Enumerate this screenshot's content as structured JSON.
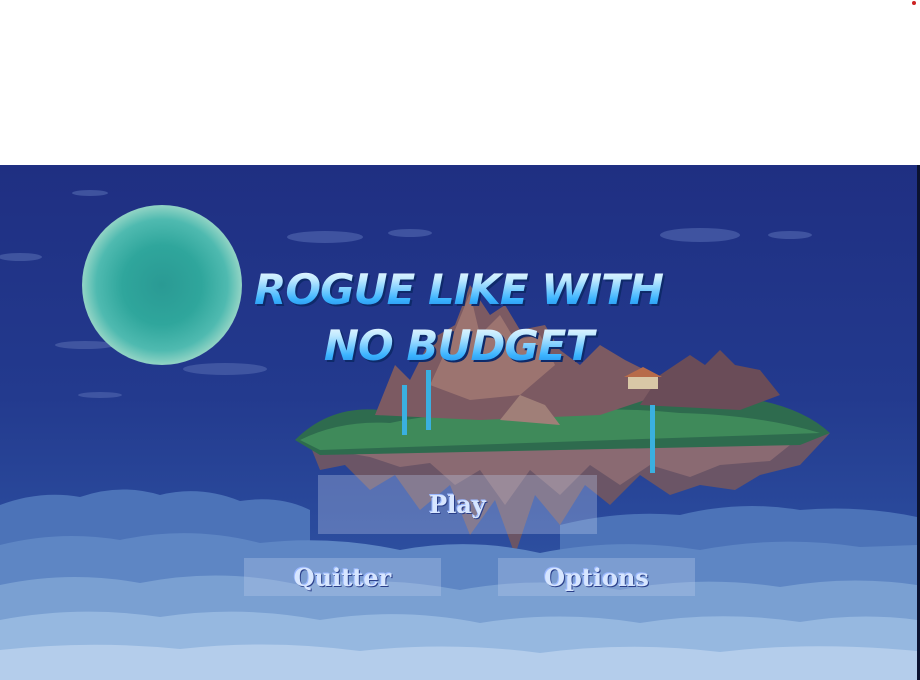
{
  "game": {
    "title_line_1": "ROGUE LIKE WITH",
    "title_line_2": "NO BUDGET"
  },
  "menu": {
    "play_label": "Play",
    "quit_label": "Quitter",
    "options_label": "Options"
  },
  "colors": {
    "sky_top": "#1f2f82",
    "sky_bottom": "#3c64ad",
    "moon": "#2fa69c",
    "title_blue": "#3ab3ff",
    "indicator_red": "#cc2222"
  },
  "icons": {
    "moon": "moon-icon",
    "island": "floating-island-icon"
  }
}
